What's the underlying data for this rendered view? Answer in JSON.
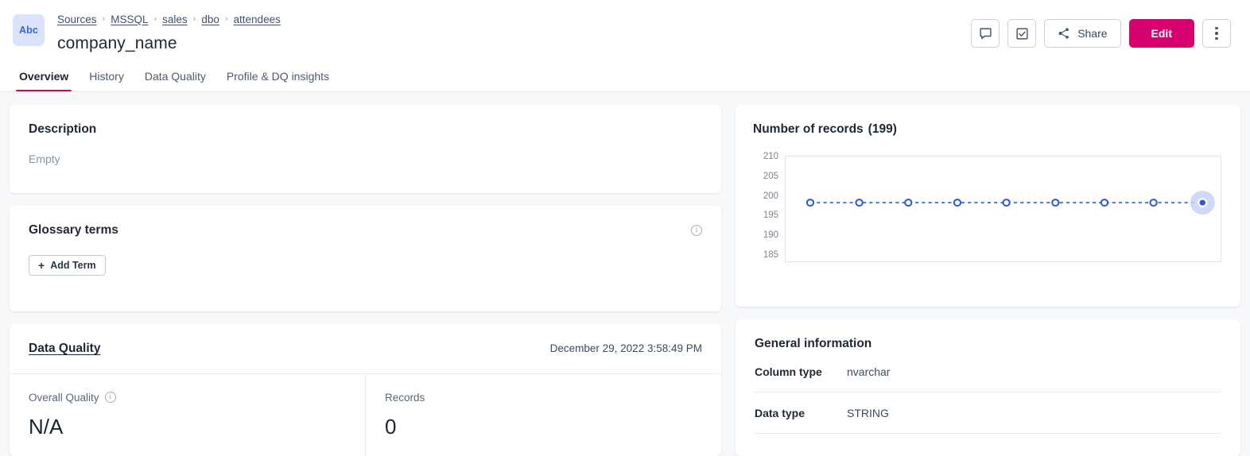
{
  "header": {
    "badge_text": "Abc",
    "breadcrumb": [
      "Sources",
      "MSSQL",
      "sales",
      "dbo",
      "attendees"
    ],
    "breadcrumb_separator": "›",
    "title": "company_name",
    "actions": {
      "comment_icon": "comment-icon",
      "task_icon": "checkbox-check-icon",
      "share_label": "Share",
      "share_icon": "share-nodes-icon",
      "edit_label": "Edit",
      "more_icon": "kebab-menu-icon"
    }
  },
  "tabs": [
    {
      "label": "Overview",
      "active": true
    },
    {
      "label": "History",
      "active": false
    },
    {
      "label": "Data Quality",
      "active": false
    },
    {
      "label": "Profile & DQ insights",
      "active": false
    }
  ],
  "description": {
    "title": "Description",
    "value": "Empty"
  },
  "glossary": {
    "title": "Glossary terms",
    "info_icon": "info-circle-icon",
    "add_button_label": "Add Term",
    "add_button_plus": "+"
  },
  "data_quality": {
    "title": "Data Quality",
    "timestamp": "December 29, 2022 3:58:49 PM",
    "metrics": [
      {
        "label": "Overall Quality",
        "value": "N/A",
        "has_info": true
      },
      {
        "label": "Records",
        "value": "0",
        "has_info": false
      }
    ]
  },
  "records_chart": {
    "title": "Number of records",
    "count_label": "(199)"
  },
  "general_information": {
    "title": "General information",
    "rows": [
      {
        "key": "Column type",
        "value": "nvarchar"
      },
      {
        "key": "Data type",
        "value": "STRING"
      }
    ]
  },
  "colors": {
    "accent_pink": "#d6006e",
    "chart_blue": "#2f55e0",
    "badge_blue_bg": "#dbe4fb",
    "page_bg": "#f6f8fa"
  },
  "chart_data": {
    "type": "line",
    "title": "Number of records  (199)",
    "xlabel": "",
    "ylabel": "",
    "ylim": [
      185,
      210
    ],
    "yticks": [
      185,
      190,
      195,
      200,
      205,
      210
    ],
    "grid": false,
    "legend": "none",
    "x": [
      1,
      2,
      3,
      4,
      5,
      6,
      7,
      8,
      9
    ],
    "values": [
      199,
      199,
      199,
      199,
      199,
      199,
      199,
      199,
      199
    ],
    "line_style": "dashed",
    "marker": "circle-open",
    "highlight_last_point": true,
    "annotations": [
      "last point highlighted with light blue halo"
    ]
  }
}
